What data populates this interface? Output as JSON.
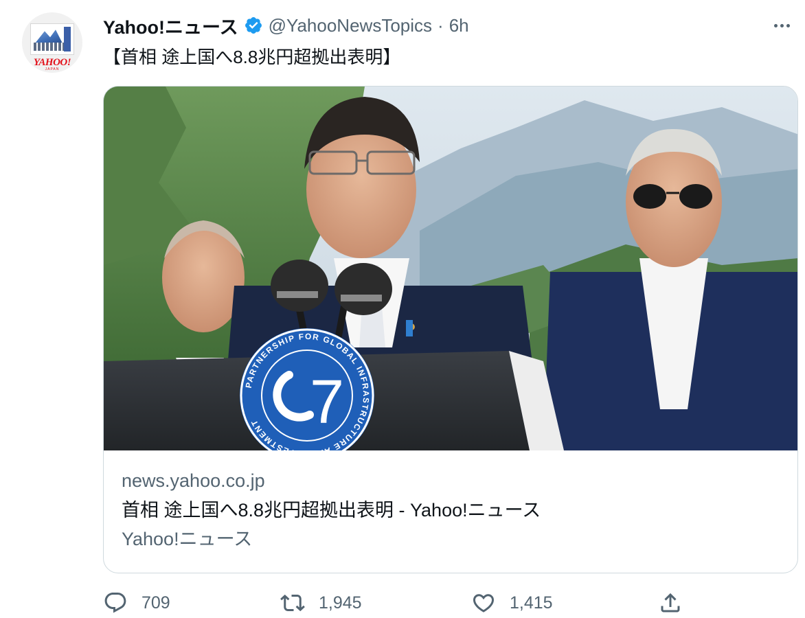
{
  "tweet": {
    "author": {
      "display_name": "Yahoo!ニュース",
      "handle": "@YahooNewsTopics",
      "avatar_wordmark": "YAHOO!",
      "avatar_sub": "JAPAN"
    },
    "separator": "·",
    "time": "6h",
    "text": "【首相 途上国へ8.8兆円超拠出表明】",
    "card": {
      "domain": "news.yahoo.co.jp",
      "title": "首相 途上国へ8.8兆円超拠出表明 - Yahoo!ニュース",
      "description": "Yahoo!ニュース",
      "image": {
        "podium_emblem_numeral": "7",
        "podium_emblem_ring_text": "PARTNERSHIP FOR GLOBAL INFRASTRUCTURE AND INVESTMENT"
      }
    },
    "actions": {
      "replies": "709",
      "retweets": "1,945",
      "likes": "1,415"
    }
  },
  "colors": {
    "verified_blue": "#1d9bf0",
    "secondary_text": "#536471",
    "card_border": "#cfd9de",
    "emblem_blue": "#1f5fb8"
  }
}
